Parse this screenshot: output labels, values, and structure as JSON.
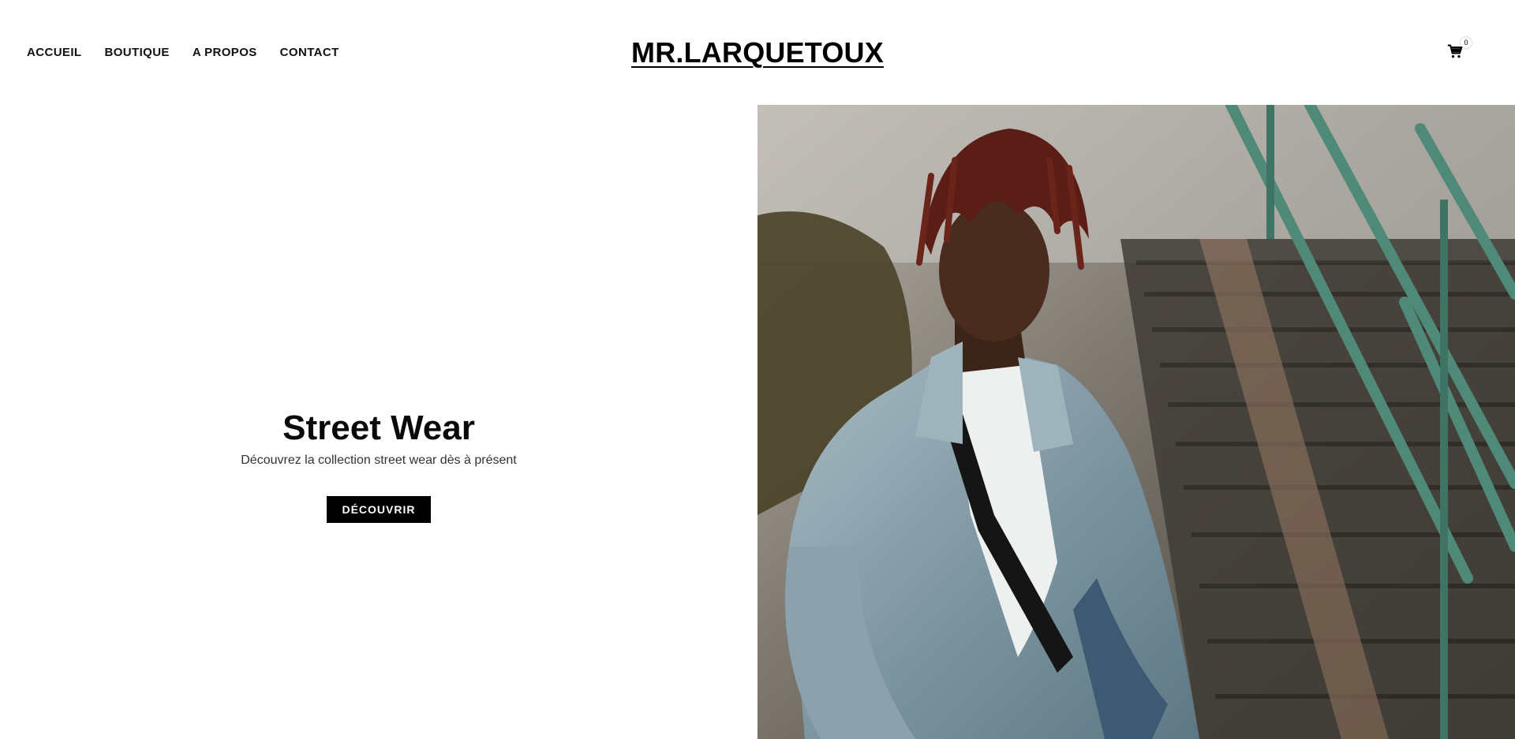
{
  "header": {
    "nav": [
      {
        "label": "ACCUEIL"
      },
      {
        "label": "BOUTIQUE"
      },
      {
        "label": "A PROPOS"
      },
      {
        "label": "CONTACT"
      }
    ],
    "logo": "MR.LARQUETOUX",
    "cart": {
      "icon": "cart-icon",
      "count": "0"
    }
  },
  "hero": {
    "title": "Street Wear",
    "subtitle": "Découvrez la collection street wear dès à présent",
    "button_label": "DÉCOUVRIR",
    "image": {
      "subject": "young man with red-tipped locs wearing acid-wash denim jacket, white t-shirt and black crossbody strap, standing in front of outdoor concrete stairs with green railings"
    }
  },
  "colors": {
    "background": "#ffffff",
    "text": "#000000",
    "button_bg": "#000000",
    "button_text": "#ffffff"
  }
}
